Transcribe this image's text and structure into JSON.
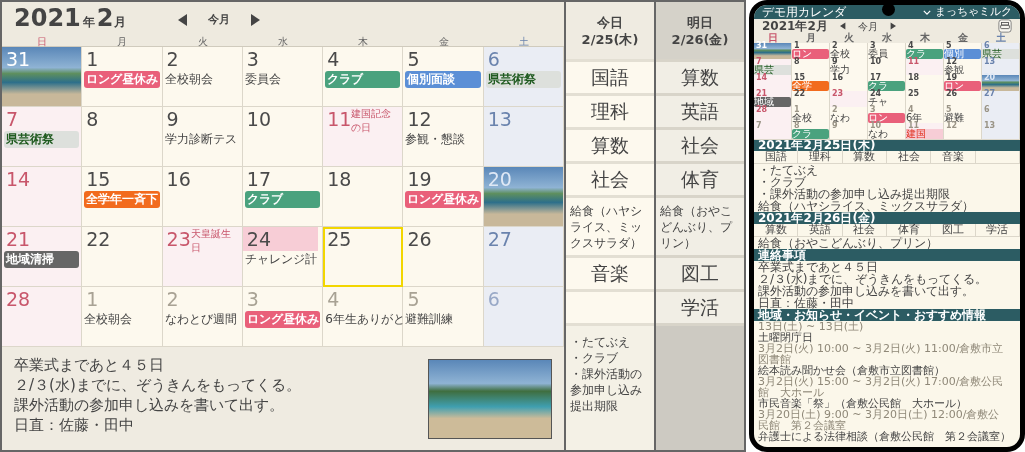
{
  "calendar": {
    "year": "2021",
    "year_unit": "年",
    "month": "2",
    "month_unit": "月",
    "today_button": "今月",
    "weekdays": [
      {
        "label": "日",
        "kind": "sun"
      },
      {
        "label": "月",
        "kind": "weekday"
      },
      {
        "label": "火",
        "kind": "weekday"
      },
      {
        "label": "水",
        "kind": "weekday"
      },
      {
        "label": "木",
        "kind": "weekday"
      },
      {
        "label": "金",
        "kind": "weekday"
      },
      {
        "label": "土",
        "kind": "sat"
      }
    ],
    "weeks": [
      [
        {
          "day": "31",
          "kind": "sun",
          "muted": true,
          "selected": false,
          "photo": true
        },
        {
          "day": "1",
          "kind": "weekday",
          "muted": false,
          "selected": false,
          "photo": false,
          "events": [
            {
              "kind": "tag",
              "text": "ロング昼休み",
              "color": "#e9607a"
            }
          ]
        },
        {
          "day": "2",
          "kind": "weekday",
          "muted": false,
          "selected": false,
          "photo": false,
          "events": [
            {
              "kind": "plain",
              "text": "全校朝会"
            }
          ]
        },
        {
          "day": "3",
          "kind": "weekday",
          "muted": false,
          "selected": false,
          "photo": false,
          "events": [
            {
              "kind": "plain",
              "text": "委員会"
            }
          ]
        },
        {
          "day": "4",
          "kind": "weekday",
          "muted": false,
          "selected": false,
          "photo": false,
          "events": [
            {
              "kind": "tag",
              "text": "クラブ",
              "color": "#4aa27e"
            }
          ]
        },
        {
          "day": "5",
          "kind": "weekday",
          "muted": false,
          "selected": false,
          "photo": false,
          "events": [
            {
              "kind": "tag",
              "text": "個別面談",
              "color": "#5b8fd6"
            }
          ]
        },
        {
          "day": "6",
          "kind": "sat",
          "muted": false,
          "selected": false,
          "photo": false,
          "events": [
            {
              "kind": "label",
              "text": "県芸術祭",
              "color": "#dde0dc"
            }
          ]
        }
      ],
      [
        {
          "day": "7",
          "kind": "sun",
          "muted": false,
          "selected": false,
          "photo": false,
          "events": [
            {
              "kind": "label",
              "text": "県芸術祭",
              "color": "#dde0dc"
            }
          ]
        },
        {
          "day": "8",
          "kind": "weekday",
          "muted": false,
          "selected": false,
          "photo": false
        },
        {
          "day": "9",
          "kind": "weekday",
          "muted": false,
          "selected": false,
          "photo": false,
          "events": [
            {
              "kind": "plain",
              "text": "学力診断テス"
            }
          ]
        },
        {
          "day": "10",
          "kind": "weekday",
          "muted": false,
          "selected": false,
          "photo": false
        },
        {
          "day": "11",
          "kind": "holiday",
          "holiday": "建国記念の日",
          "muted": false,
          "selected": false,
          "photo": false
        },
        {
          "day": "12",
          "kind": "weekday",
          "muted": false,
          "selected": false,
          "photo": false,
          "events": [
            {
              "kind": "plain",
              "text": "参観・懇談"
            }
          ]
        },
        {
          "day": "13",
          "kind": "sat",
          "muted": false,
          "selected": false,
          "photo": false
        }
      ],
      [
        {
          "day": "14",
          "kind": "sun",
          "muted": false,
          "selected": false,
          "photo": false
        },
        {
          "day": "15",
          "kind": "weekday",
          "muted": false,
          "selected": false,
          "photo": false,
          "events": [
            {
              "kind": "tag",
              "text": "全学年一斉下",
              "color": "#f26b1d"
            }
          ]
        },
        {
          "day": "16",
          "kind": "weekday",
          "muted": false,
          "selected": false,
          "photo": false
        },
        {
          "day": "17",
          "kind": "weekday",
          "muted": false,
          "selected": false,
          "photo": false,
          "events": [
            {
              "kind": "tag",
              "text": "クラブ",
              "color": "#4aa27e"
            }
          ]
        },
        {
          "day": "18",
          "kind": "weekday",
          "muted": false,
          "selected": false,
          "photo": false
        },
        {
          "day": "19",
          "kind": "weekday",
          "muted": false,
          "selected": false,
          "photo": false,
          "events": [
            {
              "kind": "tag",
              "text": "ロング昼休み",
              "color": "#e9607a"
            }
          ]
        },
        {
          "day": "20",
          "kind": "sat",
          "muted": false,
          "selected": false,
          "photo": true
        }
      ],
      [
        {
          "day": "21",
          "kind": "sun",
          "muted": false,
          "selected": false,
          "photo": false,
          "events": [
            {
              "kind": "tag",
              "text": "地域清掃",
              "color": "#666666"
            }
          ]
        },
        {
          "day": "22",
          "kind": "weekday",
          "muted": false,
          "selected": false,
          "photo": false
        },
        {
          "day": "23",
          "kind": "holiday",
          "holiday": "天皇誕生日",
          "muted": false,
          "selected": false,
          "photo": false
        },
        {
          "day": "24",
          "kind": "weekday",
          "muted": false,
          "selected": false,
          "photo": false,
          "events": [
            {
              "kind": "band",
              "color": "#f7cdd6"
            },
            {
              "kind": "plain",
              "text": "チャレンジ計"
            }
          ]
        },
        {
          "day": "25",
          "kind": "weekday",
          "muted": false,
          "selected": true,
          "photo": false
        },
        {
          "day": "26",
          "kind": "weekday",
          "muted": false,
          "selected": false,
          "photo": false
        },
        {
          "day": "27",
          "kind": "sat",
          "muted": false,
          "selected": false,
          "photo": false
        }
      ],
      [
        {
          "day": "28",
          "kind": "sun",
          "muted": false,
          "selected": false,
          "photo": false
        },
        {
          "day": "1",
          "kind": "weekday",
          "muted": true,
          "selected": false,
          "photo": false,
          "events": [
            {
              "kind": "plain",
              "text": "全校朝会"
            }
          ]
        },
        {
          "day": "2",
          "kind": "weekday",
          "muted": true,
          "selected": false,
          "photo": false,
          "events": [
            {
              "kind": "plain",
              "text": "なわとび週間"
            }
          ]
        },
        {
          "day": "3",
          "kind": "weekday",
          "muted": true,
          "selected": false,
          "photo": false,
          "events": [
            {
              "kind": "tag",
              "text": "ロング昼休み",
              "color": "#e9607a"
            }
          ]
        },
        {
          "day": "4",
          "kind": "weekday",
          "muted": true,
          "selected": false,
          "photo": false,
          "events": [
            {
              "kind": "plain",
              "text": "6年生ありがと"
            }
          ]
        },
        {
          "day": "5",
          "kind": "weekday",
          "muted": true,
          "selected": false,
          "photo": false,
          "events": [
            {
              "kind": "plain",
              "text": "避難訓練"
            }
          ]
        },
        {
          "day": "6",
          "kind": "sat",
          "muted": true,
          "selected": false,
          "photo": false
        }
      ]
    ]
  },
  "notes": {
    "lines": [
      "卒業式まであと４５日",
      "２/３(水)までに、ぞうきんをもってくる。",
      "課外活動の参加申し込みを書いて出す。",
      "日直：佐藤・田中"
    ]
  },
  "timetable": {
    "columns": [
      {
        "label": "今日",
        "date": "2/25(木)",
        "selected": true,
        "slots": [
          {
            "kind": "period",
            "text": "国語"
          },
          {
            "kind": "period",
            "text": "理科"
          },
          {
            "kind": "period",
            "text": "算数"
          },
          {
            "kind": "period",
            "text": "社会"
          },
          {
            "kind": "lunch",
            "text": "給食（ハヤシライス、ミックスサラダ）"
          },
          {
            "kind": "period",
            "text": "音楽"
          },
          {
            "kind": "empty"
          }
        ],
        "memo": [
          "・たてぶえ",
          "・クラブ",
          "・課外活動の参加申し込み提出期限"
        ]
      },
      {
        "label": "明日",
        "date": "2/26(金)",
        "selected": false,
        "slots": [
          {
            "kind": "period",
            "text": "算数"
          },
          {
            "kind": "period",
            "text": "英語"
          },
          {
            "kind": "period",
            "text": "社会"
          },
          {
            "kind": "period",
            "text": "体育"
          },
          {
            "kind": "lunch",
            "text": "給食（おやこどんぶり、プリン）"
          },
          {
            "kind": "period",
            "text": "図工"
          },
          {
            "kind": "period",
            "text": "学活"
          }
        ]
      }
    ]
  },
  "phone": {
    "app_title": "デモ用カレンダ",
    "user": "まっちゃミルク",
    "month": "2021年2月",
    "today_button": "今月",
    "weekdays": [
      {
        "label": "日",
        "kind": "sun"
      },
      {
        "label": "月",
        "kind": "weekday"
      },
      {
        "label": "火",
        "kind": "weekday"
      },
      {
        "label": "水",
        "kind": "weekday"
      },
      {
        "label": "木",
        "kind": "weekday"
      },
      {
        "label": "金",
        "kind": "weekday"
      },
      {
        "label": "土",
        "kind": "sat"
      }
    ],
    "weeks": [
      [
        {
          "day": "31",
          "kind": "sun",
          "muted": true,
          "photo": true
        },
        {
          "day": "1",
          "kind": "weekday",
          "muted": false,
          "photo": false,
          "events": [
            {
              "kind": "tag",
              "text": "ロン",
              "color": "#e9607a"
            }
          ]
        },
        {
          "day": "2",
          "kind": "weekday",
          "muted": false,
          "photo": false,
          "events": [
            {
              "kind": "plain",
              "text": "全校"
            }
          ]
        },
        {
          "day": "3",
          "kind": "weekday",
          "muted": false,
          "photo": false,
          "events": [
            {
              "kind": "plain",
              "text": "委員"
            }
          ]
        },
        {
          "day": "4",
          "kind": "weekday",
          "muted": false,
          "photo": false,
          "events": [
            {
              "kind": "tag",
              "text": "クラ",
              "color": "#4aa27e"
            }
          ]
        },
        {
          "day": "5",
          "kind": "weekday",
          "muted": false,
          "photo": false,
          "events": [
            {
              "kind": "tag",
              "text": "個別",
              "color": "#5b8fd6"
            }
          ]
        },
        {
          "day": "6",
          "kind": "sat",
          "muted": false,
          "photo": false,
          "events": [
            {
              "kind": "label",
              "text": "県芸",
              "color": "#dde0dc"
            }
          ]
        }
      ],
      [
        {
          "day": "7",
          "kind": "sun",
          "muted": false,
          "photo": false,
          "events": [
            {
              "kind": "label",
              "text": "県芸",
              "color": "#dde0dc"
            }
          ]
        },
        {
          "day": "8",
          "kind": "weekday",
          "muted": false,
          "photo": false
        },
        {
          "day": "9",
          "kind": "weekday",
          "muted": false,
          "photo": false,
          "events": [
            {
              "kind": "plain",
              "text": "学力"
            }
          ]
        },
        {
          "day": "10",
          "kind": "weekday",
          "muted": false,
          "photo": false
        },
        {
          "day": "11",
          "kind": "holiday",
          "muted": false,
          "photo": false
        },
        {
          "day": "12",
          "kind": "weekday",
          "muted": false,
          "photo": false,
          "events": [
            {
              "kind": "plain",
              "text": "参観"
            }
          ]
        },
        {
          "day": "13",
          "kind": "sat",
          "muted": false,
          "photo": false
        }
      ],
      [
        {
          "day": "14",
          "kind": "sun",
          "muted": false,
          "photo": false
        },
        {
          "day": "15",
          "kind": "weekday",
          "muted": false,
          "photo": false,
          "events": [
            {
              "kind": "tag",
              "text": "全学",
              "color": "#f26b1d"
            }
          ]
        },
        {
          "day": "16",
          "kind": "weekday",
          "muted": false,
          "photo": false
        },
        {
          "day": "17",
          "kind": "weekday",
          "muted": false,
          "photo": false,
          "events": [
            {
              "kind": "tag",
              "text": "クラ",
              "color": "#4aa27e"
            }
          ]
        },
        {
          "day": "18",
          "kind": "weekday",
          "muted": false,
          "photo": false
        },
        {
          "day": "19",
          "kind": "weekday",
          "muted": false,
          "photo": false,
          "events": [
            {
              "kind": "tag",
              "text": "ロン",
              "color": "#e9607a"
            }
          ]
        },
        {
          "day": "20",
          "kind": "sat",
          "muted": false,
          "photo": true
        }
      ],
      [
        {
          "day": "21",
          "kind": "sun",
          "muted": false,
          "photo": false,
          "events": [
            {
              "kind": "tag",
              "text": "地域",
              "color": "#666666"
            }
          ]
        },
        {
          "day": "22",
          "kind": "weekday",
          "muted": false,
          "photo": false
        },
        {
          "day": "23",
          "kind": "holiday",
          "muted": false,
          "photo": false
        },
        {
          "day": "24",
          "kind": "weekday",
          "muted": false,
          "photo": false,
          "events": [
            {
              "kind": "plain",
              "text": "チャ"
            }
          ]
        },
        {
          "day": "25",
          "kind": "weekday",
          "muted": false,
          "photo": false
        },
        {
          "day": "26",
          "kind": "weekday",
          "muted": false,
          "photo": false
        },
        {
          "day": "27",
          "kind": "sat",
          "muted": false,
          "photo": false
        }
      ],
      [
        {
          "day": "28",
          "kind": "sun",
          "muted": false,
          "photo": false
        },
        {
          "day": "1",
          "kind": "weekday",
          "muted": true,
          "photo": false,
          "events": [
            {
              "kind": "plain",
              "text": "全校"
            }
          ]
        },
        {
          "day": "2",
          "kind": "weekday",
          "muted": true,
          "photo": false,
          "events": [
            {
              "kind": "plain",
              "text": "なわ"
            }
          ]
        },
        {
          "day": "3",
          "kind": "weekday",
          "muted": true,
          "photo": false,
          "events": [
            {
              "kind": "tag",
              "text": "ロン",
              "color": "#e9607a"
            }
          ]
        },
        {
          "day": "4",
          "kind": "weekday",
          "muted": true,
          "photo": false,
          "events": [
            {
              "kind": "plain",
              "text": "6年"
            }
          ]
        },
        {
          "day": "5",
          "kind": "weekday",
          "muted": true,
          "photo": false,
          "events": [
            {
              "kind": "plain",
              "text": "避難"
            }
          ]
        },
        {
          "day": "6",
          "kind": "sat",
          "muted": true,
          "photo": false
        }
      ],
      [
        {
          "day": "7",
          "kind": "sun",
          "muted": true,
          "photo": false
        },
        {
          "day": "8",
          "kind": "weekday",
          "muted": true,
          "photo": false,
          "events": [
            {
              "kind": "tag",
              "text": "クラ",
              "color": "#4aa27e"
            }
          ]
        },
        {
          "day": "9",
          "kind": "weekday",
          "muted": true,
          "photo": false
        },
        {
          "day": "10",
          "kind": "weekday",
          "muted": true,
          "photo": false,
          "events": [
            {
              "kind": "plain",
              "text": "なわ"
            }
          ]
        },
        {
          "day": "11",
          "kind": "holiday",
          "muted": true,
          "photo": false,
          "events": [
            {
              "kind": "alert",
              "text": "建国"
            }
          ]
        },
        {
          "day": "12",
          "kind": "weekday",
          "muted": true,
          "photo": false
        },
        {
          "day": "13",
          "kind": "sat",
          "muted": true,
          "photo": false
        }
      ]
    ],
    "sections": [
      {
        "kind": "day",
        "title": "2021年2月25日(木)",
        "subjects": [
          "国語",
          "理科",
          "算数",
          "社会",
          "音楽"
        ],
        "lines": [
          "・たてぶえ",
          "・クラブ",
          "・課外活動の参加申し込み提出期限",
          "給食（ハヤシライス、ミックスサラダ）"
        ]
      },
      {
        "kind": "day",
        "title": "2021年2月26日(金)",
        "subjects": [
          "算数",
          "英語",
          "社会",
          "体育",
          "図工",
          "学活"
        ],
        "lines": [
          "給食（おやこどんぶり、プリン）"
        ]
      },
      {
        "kind": "text",
        "title": "連絡事項",
        "lines": [
          "卒業式まであと４５日",
          "２/３(水)までに、ぞうきんをもってくる。",
          "課外活動の参加申し込みを書いて出す。",
          "日直：佐藤・田中"
        ]
      },
      {
        "kind": "events",
        "title": "地域・お知らせ・イベント・おすすめ情報",
        "items": [
          {
            "when": "13日(土) ~ 13日(土)",
            "title": "土曜閉庁日"
          },
          {
            "when": "3月2日(火) 10:00 ~ 3月2日(火) 11:00/倉敷市立図書館",
            "title": "絵本読み聞かせ会（倉敷市立図書館）"
          },
          {
            "when": "3月2日(火) 15:00 ~ 3月2日(火) 17:00/倉敷公民館　大ホール",
            "title": "市民音楽「祭」（倉敷公民館　大ホール）"
          },
          {
            "when": "3月20日(土) 9:00 ~ 3月20日(土) 12:00/倉敷公民館　第２会議室",
            "title": "弁護士による法律相談（倉敷公民館　第２会議室）"
          }
        ]
      }
    ]
  }
}
